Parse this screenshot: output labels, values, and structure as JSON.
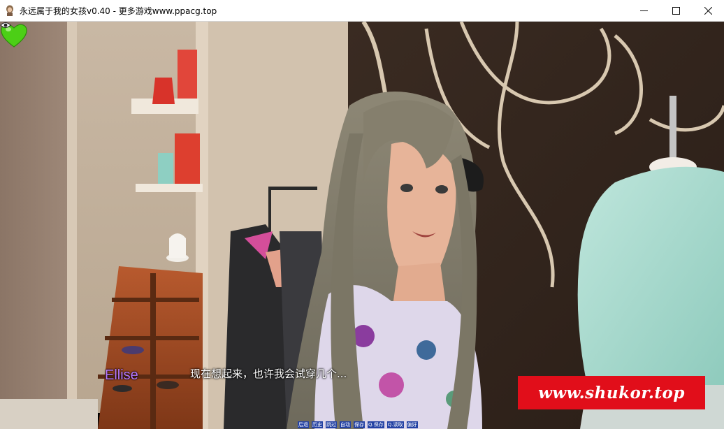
{
  "window": {
    "title": "永远属于我的女孩v0.40 - 更多游戏www.ppacg.top",
    "icons": {
      "app": "app-icon",
      "minimize": "minimize-icon",
      "maximize": "maximize-icon",
      "close": "close-icon"
    }
  },
  "hud": {
    "affection_icon": "green-heart-icon",
    "affection_color": "#4ccf16"
  },
  "dialogue": {
    "speaker": "Ellise",
    "speaker_color": "#b678ff",
    "text": "现在想起来，也许我会试穿几个..."
  },
  "watermark": {
    "text": "www.shukor.top",
    "color": "#e10e1a"
  },
  "quick_menu": {
    "items": [
      "后退",
      "历史",
      "跳过",
      "自动",
      "保存",
      "Q.保存",
      "Q.读取",
      "偏好"
    ],
    "color": "#2442a4"
  }
}
